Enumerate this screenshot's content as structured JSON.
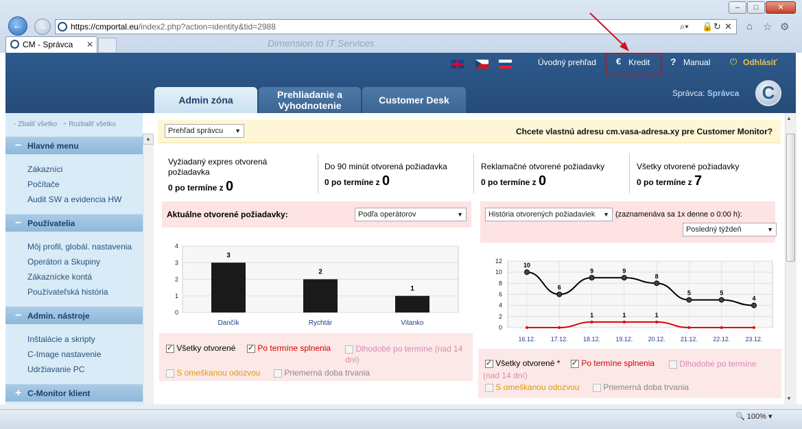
{
  "browser": {
    "url_host": "https://cmportal.eu",
    "url_rest": "/index2.php?action=identity&tid=2988",
    "tab_title": "CM - Správca",
    "ghost_text": "Dimension to IT Services",
    "zoom": "100%"
  },
  "header": {
    "nav": {
      "overview": "Úvodný prehľad",
      "credit": "Kredit",
      "manual": "Manual",
      "logout": "Odhlásiť"
    },
    "tabs": [
      {
        "label": "Admin zóna"
      },
      {
        "label": "Prehliadanie a Vyhodnotenie"
      },
      {
        "label": "Customer Desk"
      }
    ],
    "user_label": "Správca:",
    "user_name": "Správca"
  },
  "sidebar": {
    "collapse_all": "Zbaliť všetko",
    "expand_all": "Rozbaliť všetko",
    "sections": [
      {
        "title": "Hlavné menu",
        "items": [
          "Zákazníci",
          "Počítače",
          "Audit SW a evidencia HW"
        ]
      },
      {
        "title": "Používatelia",
        "items": [
          "Môj profil, globál. nastavenia",
          "Operátori a Skupiny",
          "Zákaznícke kontá",
          "Používateľská história"
        ]
      },
      {
        "title": "Admin. nástroje",
        "items": [
          "Inštalácie a skripty",
          "C-Image nastavenie",
          "Udržiavanie PC"
        ]
      },
      {
        "title": "C-Monitor klient",
        "items": []
      }
    ]
  },
  "content": {
    "view_select": "Prehľad správcu",
    "promo": "Chcete vlastnú adresu cm.vasa-adresa.xy pre Customer Monitor?",
    "stats": [
      {
        "label": "Vyžiadaný expres otvorená požiadavka",
        "count_prefix": "0 po termíne z",
        "count": "0"
      },
      {
        "label": "Do 90 minút otvorená požiadavka",
        "count_prefix": "0 po termíne z",
        "count": "0"
      },
      {
        "label": "Reklamačné otvorené požiadavky",
        "count_prefix": "0 po termíne z",
        "count": "0"
      },
      {
        "label": "Všetky otvorené požiadavky",
        "count_prefix": "0 po termíne z",
        "count": "7"
      }
    ],
    "panel1": {
      "title": "Aktuálne otvorené požiadavky:",
      "select": "Podľa operátorov",
      "legend": {
        "all": "Všetky otvorené",
        "overdue": "Po termíne splnenia",
        "long": "Dlhodobé po termíne (nad 14 dní)",
        "late": "S omeškanou odozvou",
        "avg": "Priemerná doba trvania"
      }
    },
    "panel2": {
      "select": "História otvorených požiadaviek",
      "note": "(zaznamenáva sa 1x denne o 0:00 h):",
      "period": "Posledný týždeň",
      "legend": {
        "all": "Všetky otvorené *",
        "overdue": "Po termíne splnenia",
        "long": "Dlhodobé po termíne (nad 14 dní)",
        "late": "S omeškanou odozvou",
        "avg": "Priemerná doba trvania"
      }
    }
  },
  "chart_data": [
    {
      "type": "bar",
      "categories": [
        "Dančík",
        "Rychtár",
        "Vitanko"
      ],
      "values": [
        3,
        2,
        1
      ],
      "ylim": [
        0,
        4
      ],
      "yticks": [
        0,
        1,
        2,
        3,
        4
      ],
      "color": "#1a1a1a"
    },
    {
      "type": "line",
      "x": [
        "16.12.",
        "17.12.",
        "18.12.",
        "19.12.",
        "20.12.",
        "21.12.",
        "22.12.",
        "23.12."
      ],
      "series": [
        {
          "values": [
            10,
            6,
            9,
            9,
            8,
            5,
            5,
            4
          ],
          "color": "#000000"
        },
        {
          "values": [
            0,
            0,
            1,
            1,
            1,
            0,
            0,
            0
          ],
          "color": "#e00000"
        }
      ],
      "ylim": [
        0,
        12
      ],
      "yticks": [
        0,
        2,
        4,
        6,
        8,
        10,
        12
      ]
    }
  ]
}
